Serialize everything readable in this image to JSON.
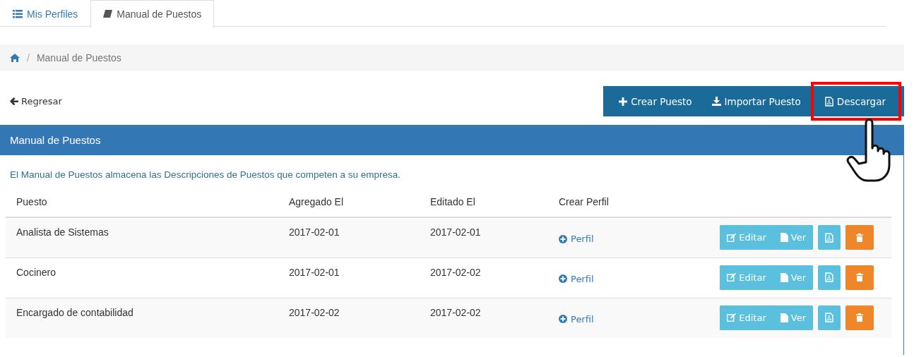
{
  "tabs": [
    {
      "label": "Mis Perfiles",
      "selected": false
    },
    {
      "label": "Manual de Puestos",
      "selected": true
    }
  ],
  "breadcrumb": {
    "separator": "/",
    "current": "Manual de Puestos"
  },
  "back_link": "Regresar",
  "toolbar": [
    {
      "label": "Crear Puesto",
      "highlighted": false
    },
    {
      "label": "Importar Puesto",
      "highlighted": false
    },
    {
      "label": "Descargar",
      "highlighted": true
    }
  ],
  "panel": {
    "title": "Manual de Puestos",
    "description": "El Manual de Puestos almacena las Descripciones de Puestos que competen a su empresa."
  },
  "table": {
    "columns": [
      "Puesto",
      "Agregado El",
      "Editado El",
      "Crear Perfil"
    ],
    "rows": [
      {
        "puesto": "Analista de Sistemas",
        "agregado": "2017-02-01",
        "editado": "2017-02-01",
        "perfil": "Perfil",
        "edit": "Editar",
        "view": "Ver"
      },
      {
        "puesto": "Cocinero",
        "agregado": "2017-02-01",
        "editado": "2017-02-02",
        "perfil": "Perfil",
        "edit": "Editar",
        "view": "Ver"
      },
      {
        "puesto": "Encargado de contabilidad",
        "agregado": "2017-02-02",
        "editado": "2017-02-02",
        "perfil": "Perfil",
        "edit": "Editar",
        "view": "Ver"
      }
    ]
  }
}
